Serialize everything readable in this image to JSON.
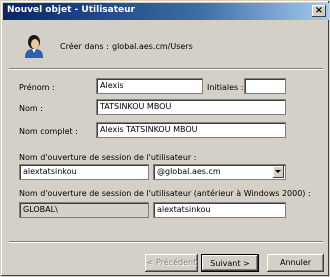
{
  "window": {
    "title": "Nouvel objet - Utilisateur",
    "close_label": "×"
  },
  "header": {
    "icon": "user-icon",
    "created_in_label": "Créer dans :",
    "created_in_value": "global.aes.cm/Users"
  },
  "form": {
    "first_name_label": "Prénom :",
    "first_name_value": "Alexis",
    "initials_label": "Initiales :",
    "initials_value": "",
    "last_name_label": "Nom :",
    "last_name_value": "TATSINKOU MBOU",
    "full_name_label": "Nom complet :",
    "full_name_value": "Alexis TATSINKOU MBOU",
    "logon_label": "Nom d'ouverture de session de l'utilisateur :",
    "logon_value": "alextatsinkou",
    "domain_value": "@global.aes.cm",
    "pre2000_label": "Nom d'ouverture de session de l'utilisateur (antérieur à Windows 2000) :",
    "pre2000_domain": "GLOBAL\\",
    "pre2000_value": "alextatsinkou"
  },
  "buttons": {
    "previous": "< Précédent",
    "next": "Suivant >",
    "cancel": "Annuler"
  },
  "colors": {
    "titlebar_start": "#0a246a",
    "titlebar_end": "#a6caf0",
    "dialog_bg": "#d4d0c8"
  }
}
